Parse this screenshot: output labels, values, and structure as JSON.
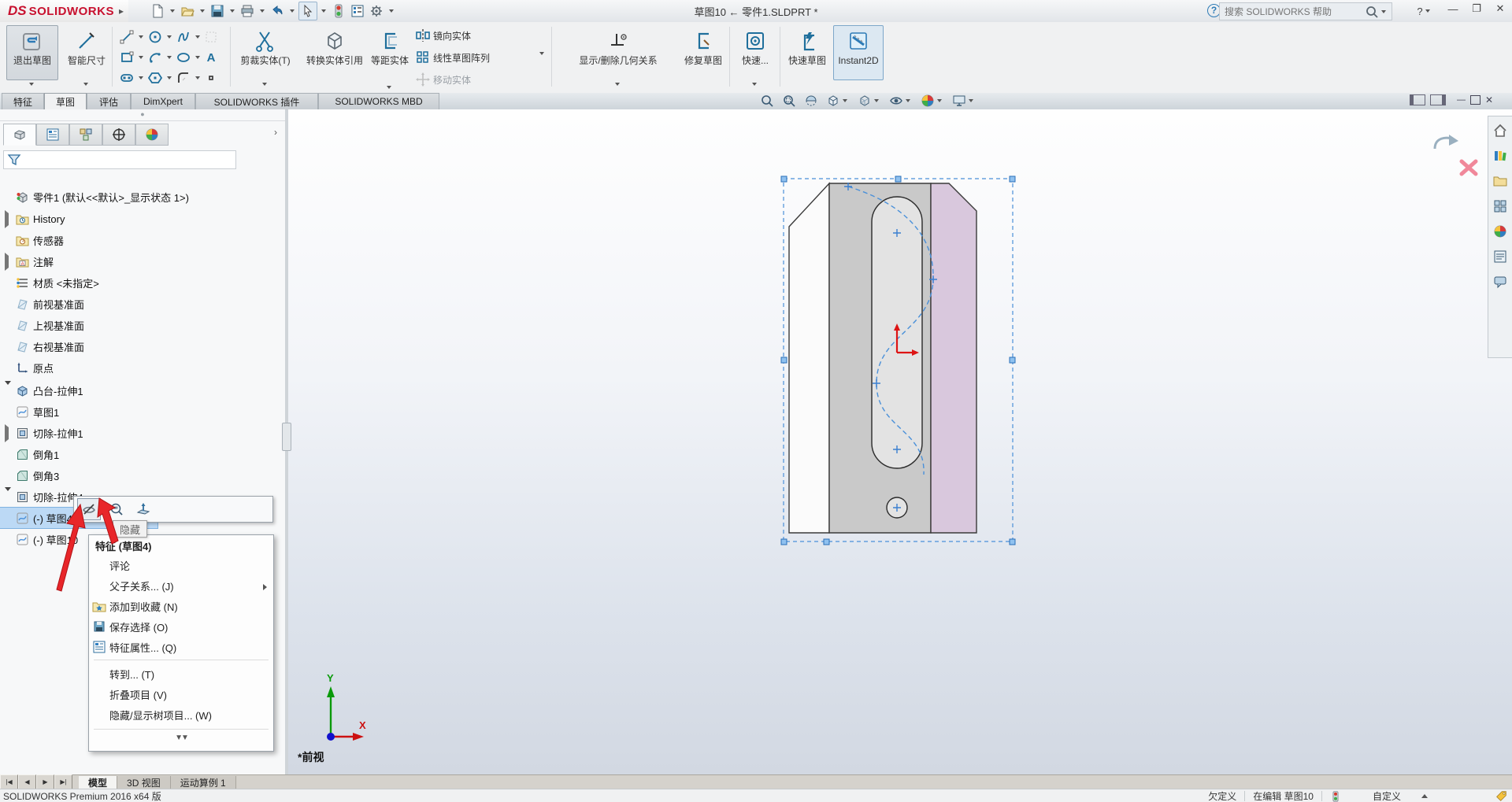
{
  "titlebar": {
    "brand": "SOLIDWORKS",
    "brand_prefix": "DS",
    "title": "草图10 ← 零件1.SLDPRT *",
    "search_placeholder": "搜索 SOLIDWORKS 帮助",
    "help_label": "?"
  },
  "ribbon": {
    "exit_sketch": "退出草图",
    "smart_dimension": "智能尺寸",
    "trim": "剪裁实体(T)",
    "convert": "转换实体引用",
    "offset": "等距实体",
    "mirror": "镜向实体",
    "linear_pattern": "线性草图阵列",
    "move": "移动实体",
    "relations": "显示/删除几何关系",
    "repair": "修复草图",
    "quick_snaps": "快速...",
    "rapid_sketch": "快速草图",
    "instant2d": "Instant2D",
    "text_tool": "A"
  },
  "command_tabs": [
    "特征",
    "草图",
    "评估",
    "DimXpert",
    "SOLIDWORKS 插件",
    "SOLIDWORKS MBD"
  ],
  "tree": {
    "root": "零件1 (默认<<默认>_显示状态 1>)",
    "items": [
      "History",
      "传感器",
      "注解",
      "材质 <未指定>",
      "前视基准面",
      "上视基准面",
      "右视基准面",
      "原点",
      "凸台-拉伸1",
      "草图1",
      "切除-拉伸1",
      "倒角1",
      "倒角3",
      "切除-拉伸4",
      "(-) 草图4",
      "(-) 草图10"
    ]
  },
  "popup": {
    "tooltip": "隐藏"
  },
  "menu": {
    "header": "特征 (草图4)",
    "items": [
      "评论",
      "父子关系... (J)",
      "添加到收藏 (N)",
      "保存选择 (O)",
      "特征属性... (Q)",
      "转到... (T)",
      "折叠项目 (V)",
      "隐藏/显示树项目... (W)"
    ]
  },
  "viewport": {
    "view_label": "*前视",
    "axis_x": "X",
    "axis_y": "Y"
  },
  "bottom_tabs": [
    "模型",
    "3D 视图",
    "运动算例 1"
  ],
  "status": {
    "version": "SOLIDWORKS Premium 2016 x64 版",
    "state": "欠定义",
    "editing": "在编辑 草图10",
    "custom": "自定义"
  }
}
